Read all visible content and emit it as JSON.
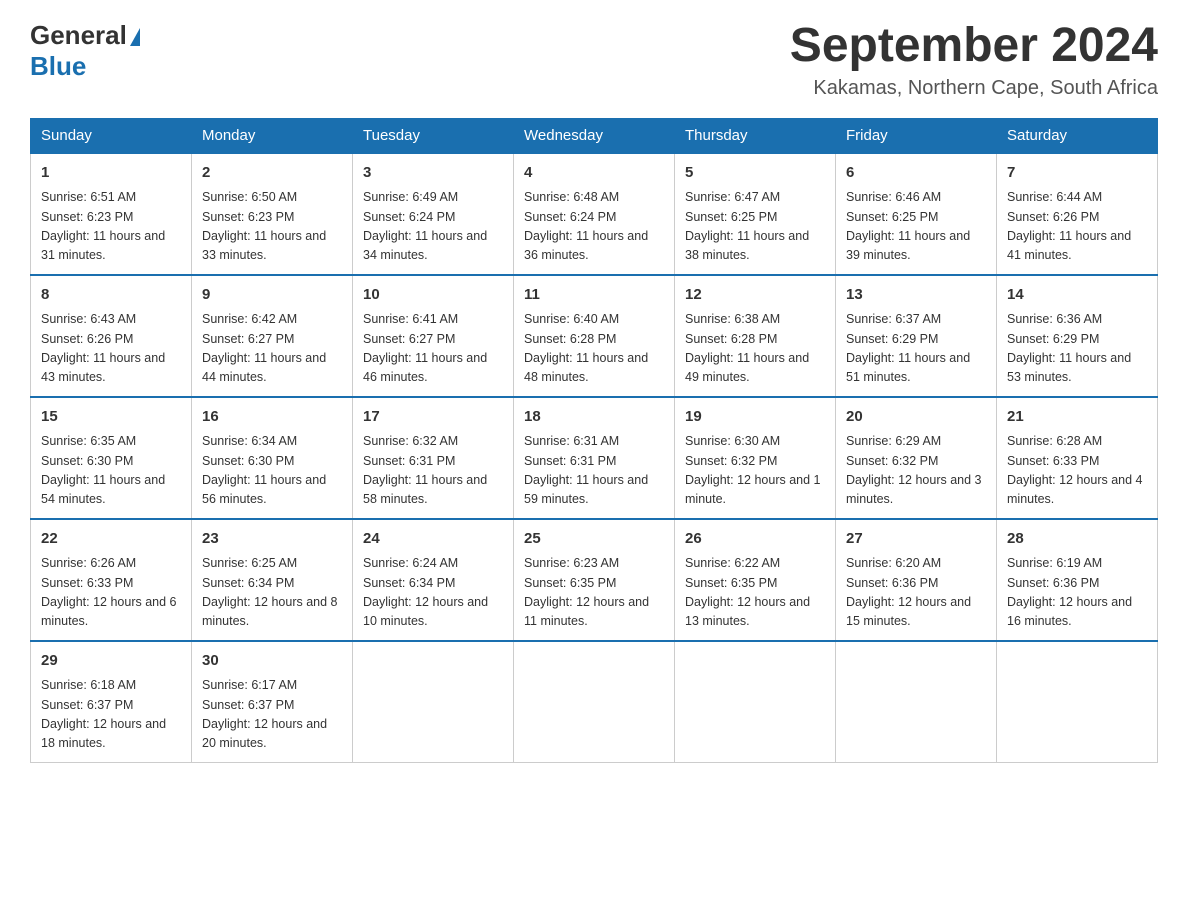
{
  "header": {
    "logo_general": "General",
    "logo_blue": "Blue",
    "title": "September 2024",
    "subtitle": "Kakamas, Northern Cape, South Africa"
  },
  "weekdays": [
    "Sunday",
    "Monday",
    "Tuesday",
    "Wednesday",
    "Thursday",
    "Friday",
    "Saturday"
  ],
  "weeks": [
    [
      {
        "day": "1",
        "sunrise": "6:51 AM",
        "sunset": "6:23 PM",
        "daylight": "11 hours and 31 minutes."
      },
      {
        "day": "2",
        "sunrise": "6:50 AM",
        "sunset": "6:23 PM",
        "daylight": "11 hours and 33 minutes."
      },
      {
        "day": "3",
        "sunrise": "6:49 AM",
        "sunset": "6:24 PM",
        "daylight": "11 hours and 34 minutes."
      },
      {
        "day": "4",
        "sunrise": "6:48 AM",
        "sunset": "6:24 PM",
        "daylight": "11 hours and 36 minutes."
      },
      {
        "day": "5",
        "sunrise": "6:47 AM",
        "sunset": "6:25 PM",
        "daylight": "11 hours and 38 minutes."
      },
      {
        "day": "6",
        "sunrise": "6:46 AM",
        "sunset": "6:25 PM",
        "daylight": "11 hours and 39 minutes."
      },
      {
        "day": "7",
        "sunrise": "6:44 AM",
        "sunset": "6:26 PM",
        "daylight": "11 hours and 41 minutes."
      }
    ],
    [
      {
        "day": "8",
        "sunrise": "6:43 AM",
        "sunset": "6:26 PM",
        "daylight": "11 hours and 43 minutes."
      },
      {
        "day": "9",
        "sunrise": "6:42 AM",
        "sunset": "6:27 PM",
        "daylight": "11 hours and 44 minutes."
      },
      {
        "day": "10",
        "sunrise": "6:41 AM",
        "sunset": "6:27 PM",
        "daylight": "11 hours and 46 minutes."
      },
      {
        "day": "11",
        "sunrise": "6:40 AM",
        "sunset": "6:28 PM",
        "daylight": "11 hours and 48 minutes."
      },
      {
        "day": "12",
        "sunrise": "6:38 AM",
        "sunset": "6:28 PM",
        "daylight": "11 hours and 49 minutes."
      },
      {
        "day": "13",
        "sunrise": "6:37 AM",
        "sunset": "6:29 PM",
        "daylight": "11 hours and 51 minutes."
      },
      {
        "day": "14",
        "sunrise": "6:36 AM",
        "sunset": "6:29 PM",
        "daylight": "11 hours and 53 minutes."
      }
    ],
    [
      {
        "day": "15",
        "sunrise": "6:35 AM",
        "sunset": "6:30 PM",
        "daylight": "11 hours and 54 minutes."
      },
      {
        "day": "16",
        "sunrise": "6:34 AM",
        "sunset": "6:30 PM",
        "daylight": "11 hours and 56 minutes."
      },
      {
        "day": "17",
        "sunrise": "6:32 AM",
        "sunset": "6:31 PM",
        "daylight": "11 hours and 58 minutes."
      },
      {
        "day": "18",
        "sunrise": "6:31 AM",
        "sunset": "6:31 PM",
        "daylight": "11 hours and 59 minutes."
      },
      {
        "day": "19",
        "sunrise": "6:30 AM",
        "sunset": "6:32 PM",
        "daylight": "12 hours and 1 minute."
      },
      {
        "day": "20",
        "sunrise": "6:29 AM",
        "sunset": "6:32 PM",
        "daylight": "12 hours and 3 minutes."
      },
      {
        "day": "21",
        "sunrise": "6:28 AM",
        "sunset": "6:33 PM",
        "daylight": "12 hours and 4 minutes."
      }
    ],
    [
      {
        "day": "22",
        "sunrise": "6:26 AM",
        "sunset": "6:33 PM",
        "daylight": "12 hours and 6 minutes."
      },
      {
        "day": "23",
        "sunrise": "6:25 AM",
        "sunset": "6:34 PM",
        "daylight": "12 hours and 8 minutes."
      },
      {
        "day": "24",
        "sunrise": "6:24 AM",
        "sunset": "6:34 PM",
        "daylight": "12 hours and 10 minutes."
      },
      {
        "day": "25",
        "sunrise": "6:23 AM",
        "sunset": "6:35 PM",
        "daylight": "12 hours and 11 minutes."
      },
      {
        "day": "26",
        "sunrise": "6:22 AM",
        "sunset": "6:35 PM",
        "daylight": "12 hours and 13 minutes."
      },
      {
        "day": "27",
        "sunrise": "6:20 AM",
        "sunset": "6:36 PM",
        "daylight": "12 hours and 15 minutes."
      },
      {
        "day": "28",
        "sunrise": "6:19 AM",
        "sunset": "6:36 PM",
        "daylight": "12 hours and 16 minutes."
      }
    ],
    [
      {
        "day": "29",
        "sunrise": "6:18 AM",
        "sunset": "6:37 PM",
        "daylight": "12 hours and 18 minutes."
      },
      {
        "day": "30",
        "sunrise": "6:17 AM",
        "sunset": "6:37 PM",
        "daylight": "12 hours and 20 minutes."
      },
      null,
      null,
      null,
      null,
      null
    ]
  ]
}
